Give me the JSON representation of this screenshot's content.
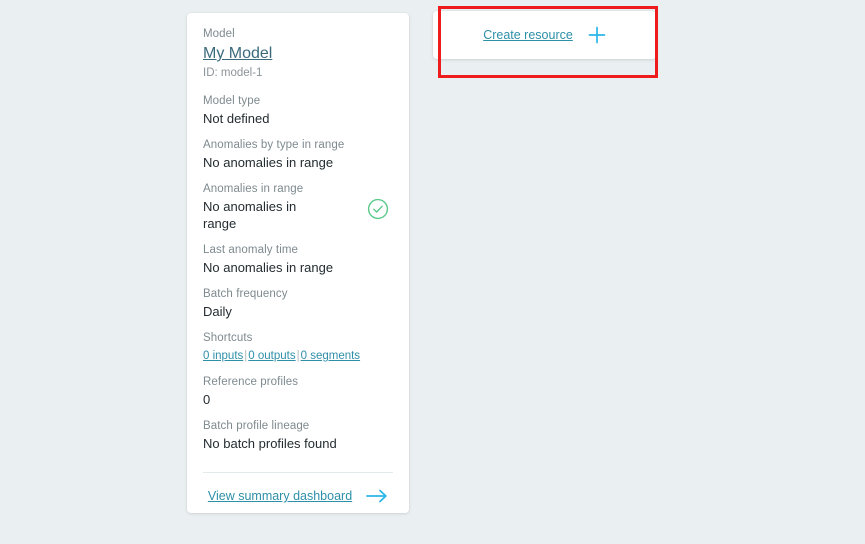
{
  "colors": {
    "background": "#eaeff1",
    "card": "#ffffff",
    "label": "#7e8a8f",
    "value": "#232c31",
    "link_teal": "#2e8fa8",
    "model_link": "#3b6a7d",
    "status_green": "#5cc98a",
    "highlight_red": "#ee1c1c",
    "plus_blue": "#29b6e8"
  },
  "model_card": {
    "model": {
      "label": "Model",
      "name": "My Model",
      "id": "ID: model-1"
    },
    "fields": [
      {
        "label": "Model type",
        "value": "Not defined"
      },
      {
        "label": "Anomalies by type in range",
        "value": "No anomalies in range"
      }
    ],
    "anomalies_in_range": {
      "label": "Anomalies in range",
      "value": "No anomalies in range",
      "status_icon": "check-circle-icon"
    },
    "fields_after": [
      {
        "label": "Last anomaly time",
        "value": "No anomalies in range"
      },
      {
        "label": "Batch frequency",
        "value": "Daily"
      }
    ],
    "shortcuts": {
      "label": "Shortcuts",
      "links": [
        {
          "text": "0 inputs"
        },
        {
          "text": "0 outputs"
        },
        {
          "text": "0 segments"
        }
      ],
      "separator": "|"
    },
    "fields_tail": [
      {
        "label": "Reference profiles",
        "value": "0"
      },
      {
        "label": "Batch profile lineage",
        "value": "No batch profiles found"
      }
    ],
    "footer": {
      "link_text": "View summary dashboard",
      "arrow_icon": "arrow-right-icon"
    }
  },
  "create_resource": {
    "link_text": "Create resource",
    "plus_icon": "plus-icon"
  },
  "annotation": {
    "type": "highlight-rectangle"
  }
}
